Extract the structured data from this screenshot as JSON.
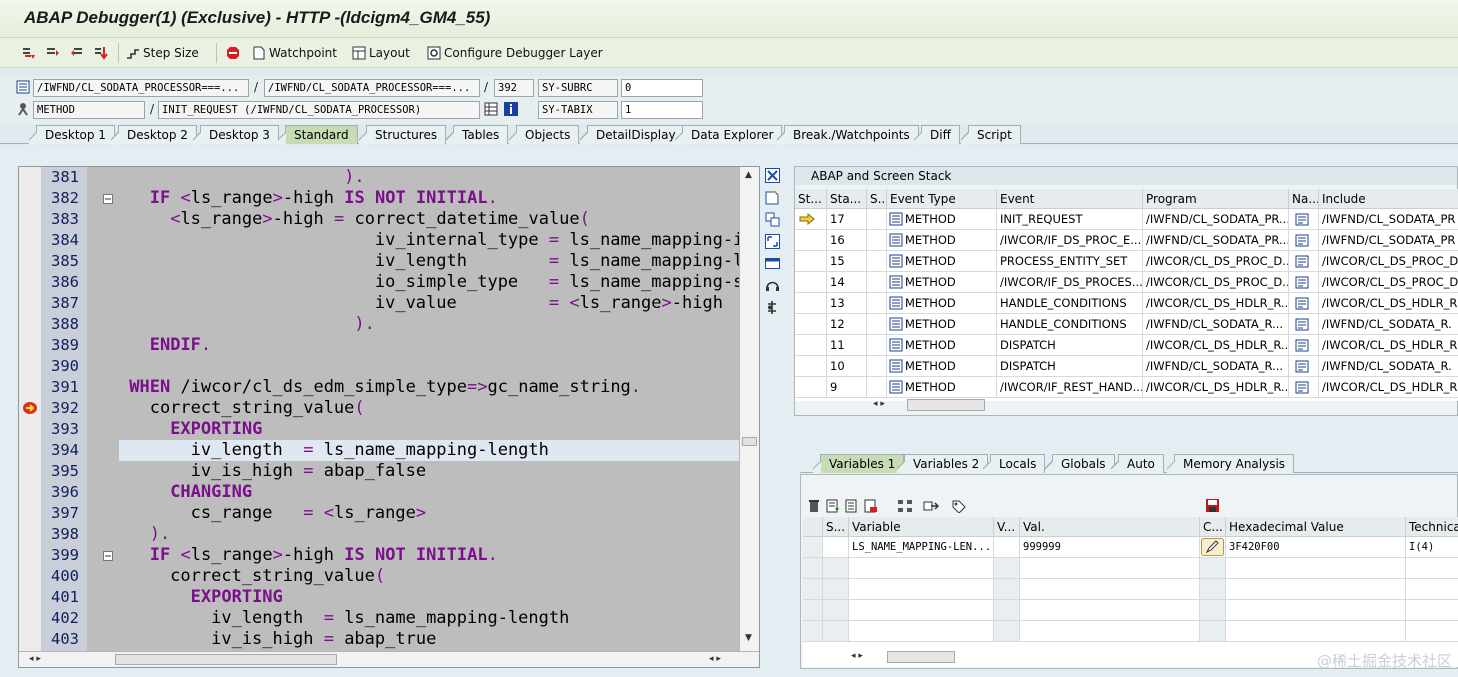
{
  "window": {
    "title": "ABAP Debugger(1)  (Exclusive) - HTTP -(ldcigm4_GM4_55)"
  },
  "toolbar": {
    "step_size": "Step Size",
    "watchpoint": "Watchpoint",
    "layout": "Layout",
    "configure": "Configure Debugger Layer"
  },
  "info": {
    "program1": "/IWFND/CL_SODATA_PROCESSOR===...",
    "program2": "/IWFND/CL_SODATA_PROCESSOR===...",
    "line": "392",
    "sy_subrc_label": "SY-SUBRC",
    "sy_subrc_value": "0",
    "event_type": "METHOD",
    "event": "INIT_REQUEST (/IWFND/CL_SODATA_PROCESSOR)",
    "sy_tabix_label": "SY-TABIX",
    "sy_tabix_value": "1"
  },
  "tabs": [
    "Desktop 1",
    "Desktop 2",
    "Desktop 3",
    "Standard",
    "Structures",
    "Tables",
    "Objects",
    "DetailDisplay",
    "Data Explorer",
    "Break./Watchpoints",
    "Diff",
    "Script"
  ],
  "code": [
    {
      "n": "381",
      "html": "<span class='pu'>                      ).</span>"
    },
    {
      "n": "382",
      "html": "   <span class='kw'>IF</span> <span class='pu'>&lt;</span>ls_range<span class='pu'>&gt;</span>-high <span class='kw'>IS NOT INITIAL</span><span class='pu'>.</span>"
    },
    {
      "n": "383",
      "html": "     <span class='pu'>&lt;</span>ls_range<span class='pu'>&gt;</span>-high <span class='pu'>=</span> correct_datetime_value<span class='pu'>(</span>"
    },
    {
      "n": "384",
      "html": "                         iv_internal_type <span class='pu'>=</span> ls_name_mapping-internal_type"
    },
    {
      "n": "385",
      "html": "                         iv_length        <span class='pu'>=</span> ls_name_mapping-length"
    },
    {
      "n": "386",
      "html": "                         io_simple_type   <span class='pu'>=</span> ls_name_mapping-simple_type"
    },
    {
      "n": "387",
      "html": "                         iv_value         <span class='pu'>=</span> <span class='pu'>&lt;</span>ls_range<span class='pu'>&gt;</span>-high"
    },
    {
      "n": "388",
      "html": "<span class='pu'>                       ).</span>"
    },
    {
      "n": "389",
      "html": "   <span class='kw'>ENDIF</span><span class='pu'>.</span>"
    },
    {
      "n": "390",
      "html": ""
    },
    {
      "n": "391",
      "html": " <span class='kw'>WHEN</span> /iwcor/cl_ds_edm_simple_type<span class='pu'>=&gt;</span>gc_name_string<span class='pu'>.</span>"
    },
    {
      "n": "392",
      "html": "   correct_string_value<span class='pu'>(</span>"
    },
    {
      "n": "393",
      "html": "     <span class='kw'>EXPORTING</span>"
    },
    {
      "n": "394",
      "html": "       iv_length  <span class='pu'>=</span> ls_name_mapping-length",
      "hl": true
    },
    {
      "n": "395",
      "html": "       iv_is_high <span class='pu'>=</span> abap_false"
    },
    {
      "n": "396",
      "html": "     <span class='kw'>CHANGING</span>"
    },
    {
      "n": "397",
      "html": "       cs_range   <span class='pu'>=</span> <span class='pu'>&lt;</span>ls_range<span class='pu'>&gt;</span>"
    },
    {
      "n": "398",
      "html": "<span class='pu'>   ).</span>"
    },
    {
      "n": "399",
      "html": "   <span class='kw'>IF</span> <span class='pu'>&lt;</span>ls_range<span class='pu'>&gt;</span>-high <span class='kw'>IS NOT INITIAL</span><span class='pu'>.</span>"
    },
    {
      "n": "400",
      "html": "     correct_string_value<span class='pu'>(</span>"
    },
    {
      "n": "401",
      "html": "       <span class='kw'>EXPORTING</span>"
    },
    {
      "n": "402",
      "html": "         iv_length  <span class='pu'>=</span> ls_name_mapping-length"
    },
    {
      "n": "403",
      "html": "         iv_is_high <span class='pu'>=</span> abap_true"
    }
  ],
  "stack": {
    "title": "ABAP and Screen Stack",
    "headers": [
      "St...",
      "Sta...",
      "S...",
      "Event Type",
      "Event",
      "Program",
      "Na...",
      "Include"
    ],
    "rows": [
      [
        "17",
        "METHOD",
        "INIT_REQUEST",
        "/IWFND/CL_SODATA_PR...",
        "/IWFND/CL_SODATA_PR"
      ],
      [
        "16",
        "METHOD",
        "/IWCOR/IF_DS_PROC_E...",
        "/IWFND/CL_SODATA_PR...",
        "/IWFND/CL_SODATA_PR"
      ],
      [
        "15",
        "METHOD",
        "PROCESS_ENTITY_SET",
        "/IWCOR/CL_DS_PROC_D...",
        "/IWCOR/CL_DS_PROC_D"
      ],
      [
        "14",
        "METHOD",
        "/IWCOR/IF_DS_PROCES...",
        "/IWCOR/CL_DS_PROC_D...",
        "/IWCOR/CL_DS_PROC_D"
      ],
      [
        "13",
        "METHOD",
        "HANDLE_CONDITIONS",
        "/IWCOR/CL_DS_HDLR_R...",
        "/IWCOR/CL_DS_HDLR_R."
      ],
      [
        "12",
        "METHOD",
        "HANDLE_CONDITIONS",
        "/IWFND/CL_SODATA_R...",
        "/IWFND/CL_SODATA_R."
      ],
      [
        "11",
        "METHOD",
        "DISPATCH",
        "/IWCOR/CL_DS_HDLR_R...",
        "/IWCOR/CL_DS_HDLR_R."
      ],
      [
        "10",
        "METHOD",
        "DISPATCH",
        "/IWFND/CL_SODATA_R...",
        "/IWFND/CL_SODATA_R."
      ],
      [
        "9",
        "METHOD",
        "/IWCOR/IF_REST_HAND...",
        "/IWCOR/CL_DS_HDLR_R...",
        "/IWCOR/CL_DS_HDLR_R."
      ]
    ]
  },
  "vartabs": [
    "Variables 1",
    "Variables 2",
    "Locals",
    "Globals",
    "Auto",
    "Memory Analysis"
  ],
  "vars": {
    "headers": [
      "S...",
      "Variable",
      "V...",
      "Val.",
      "C...",
      "Hexadecimal Value",
      "Technical"
    ],
    "row": {
      "variable": "LS_NAME_MAPPING-LEN...",
      "value": "999999",
      "hex": "3F420F00",
      "tech": "I(4)"
    }
  },
  "watermark": "@稀土掘金技术社区",
  "colors": {
    "accent_tab": "#c7dbb4",
    "code_bg": "#bdbdbd",
    "keyword": "#7a0f8a"
  }
}
